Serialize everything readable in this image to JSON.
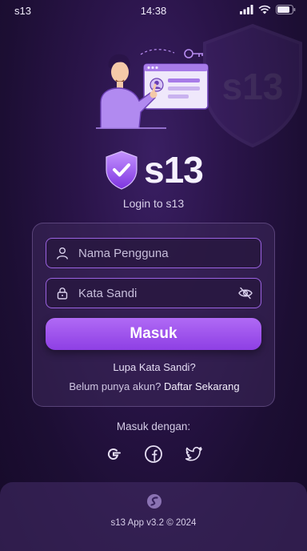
{
  "status_bar": {
    "app_name": "s13",
    "time": "14:38"
  },
  "brand": {
    "name": "s13",
    "subtitle": "Login to s13",
    "watermark_text": "s13"
  },
  "login_form": {
    "username_placeholder": "Nama Pengguna",
    "username_value": "",
    "password_placeholder": "Kata Sandi",
    "password_value": "",
    "submit_label": "Masuk",
    "forgot_label": "Lupa Kata Sandi?",
    "register_prompt": "Belum punya akun?",
    "register_link": "Daftar Sekarang"
  },
  "social_login": {
    "label": "Masuk dengan:",
    "providers": [
      "google-icon",
      "facebook-icon",
      "twitter-icon"
    ]
  },
  "footer": {
    "version_text": "s13 App v3.2 © 2024"
  },
  "colors": {
    "accent": "#9a4dea",
    "background": "#2a1449",
    "button_gradient_top": "#b06af5",
    "button_gradient_bottom": "#8e3fe4"
  }
}
